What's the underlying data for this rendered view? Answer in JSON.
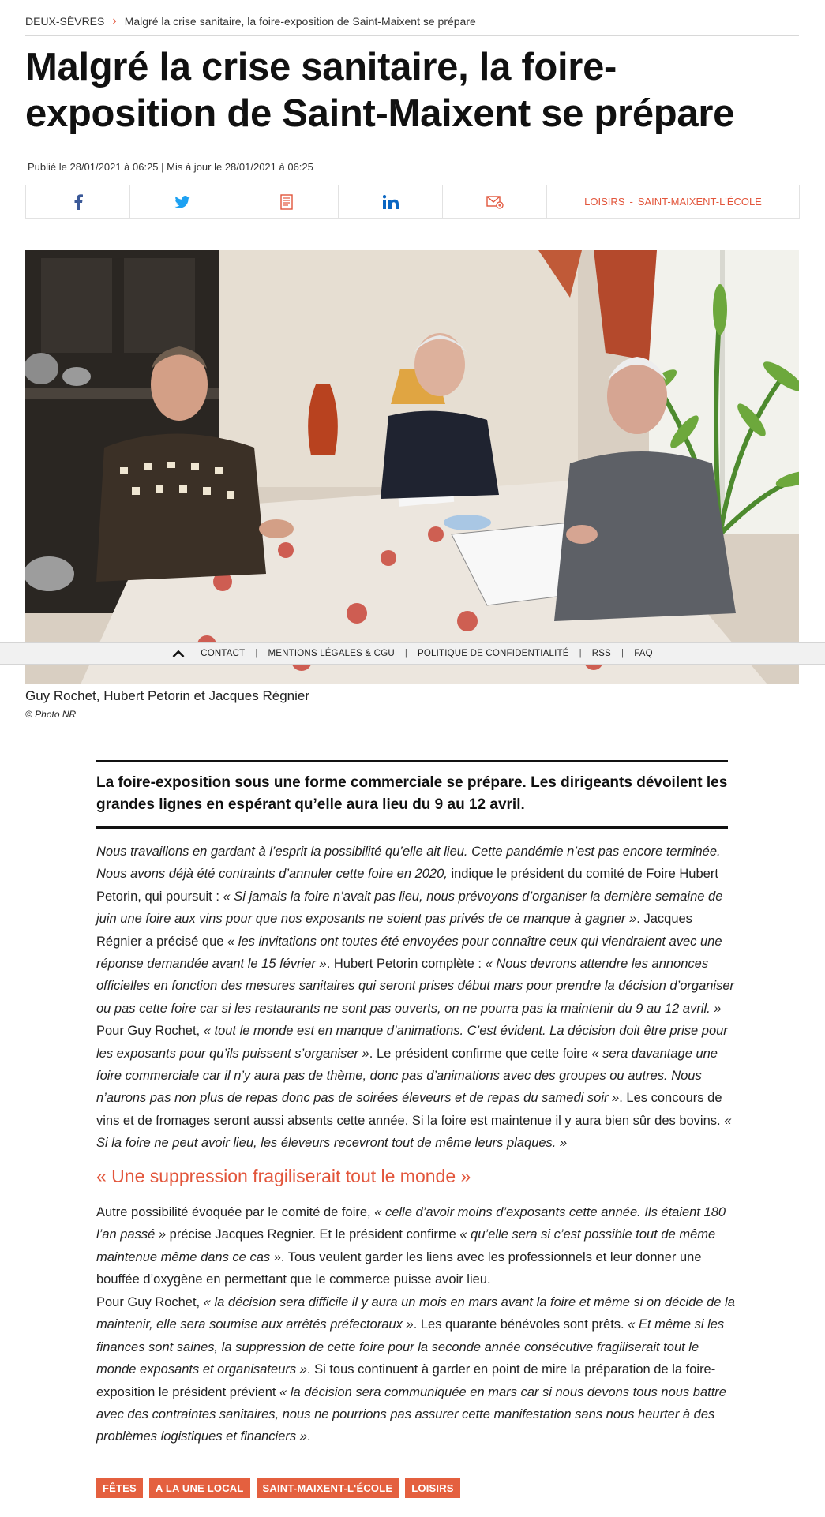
{
  "breadcrumb": {
    "section": "DEUX-SÈVRES",
    "separator": "›",
    "current": "Malgré la crise sanitaire, la foire-exposition de Saint-Maixent se prépare"
  },
  "article": {
    "title": "Malgré la crise sanitaire, la foire-exposition de Saint-Maixent se prépare",
    "dates": "Publié le 28/01/2021 à 06:25 | Mis à jour le 28/01/2021 à 06:25",
    "share": {
      "icons": [
        "facebook-icon",
        "twitter-icon",
        "print-icon",
        "linkedin-icon",
        "email-icon"
      ],
      "tag_1": "LOISIRS",
      "tag_dash": "-",
      "tag_2": "SAINT-MAIXENT-L'ÉCOLE"
    },
    "caption": "Guy Rochet, Hubert Petorin et Jacques Régnier",
    "credit": "© Photo NR",
    "chapo": "La foire-exposition sous une forme commerciale se prépare. Les dirigeants dévoilent les grandes lignes en espérant qu’elle aura lieu du 9 au 12 avril.",
    "p1": {
      "a": "Nous travaillons en gardant à l’esprit la possibilité qu’elle ait lieu. Cette pandémie n’est pas encore terminée. Nous avons déjà été contraints d’annuler cette foire en 2020,",
      "b": " indique le président du comité de Foire Hubert Petorin, qui poursuit : ",
      "c": "« Si jamais la foire n’avait pas lieu, nous prévoyons d’organiser la dernière semaine de juin une foire aux vins pour que nos exposants ne soient pas privés de ce manque à gagner »",
      "d": ". Jacques Régnier a précisé que ",
      "e": "« les invitations ont toutes été envoyées pour connaître ceux qui viendraient avec une réponse demandée avant le 15 février »",
      "f": ". Hubert Petorin complète : ",
      "g": "« Nous devrons attendre les annonces officielles en fonction des mesures sanitaires qui seront prises début mars pour prendre la décision d’organiser ou pas cette foire car si les restaurants ne sont pas ouverts, on ne pourra pas la maintenir du 9 au 12 avril. »",
      "h": " Pour Guy Rochet, ",
      "i": "« tout le monde est en manque d’animations. C’est évident. La décision doit être prise pour les exposants pour qu’ils puissent s’organiser »",
      "j": ". Le président confirme que cette foire ",
      "k": "« sera davantage une foire commerciale car il n’y aura pas de thème, donc pas d’animations avec des groupes ou autres. Nous n’aurons pas non plus de repas donc pas de soirées éleveurs et de repas du samedi soir »",
      "l": ". Les concours de vins et de fromages seront aussi absents cette année. Si la foire est maintenue il y aura bien sûr des bovins. ",
      "m": "« Si la foire ne peut avoir lieu, les éleveurs recevront tout de même leurs plaques. »"
    },
    "subhead": "« Une suppression fragiliserait tout le monde »",
    "p2": {
      "a": "Autre possibilité évoquée par le comité de foire, ",
      "b": "« celle d’avoir moins d’exposants cette année. Ils étaient 180 l’an passé »",
      "c": " précise Jacques Regnier. Et le président confirme ",
      "d": "« qu’elle sera si c’est possible tout de même maintenue même dans ce cas »",
      "e": ". Tous veulent garder les liens avec les professionnels et leur donner une bouffée d’oxygène en permettant que le commerce puisse avoir lieu."
    },
    "p3": {
      "a": "Pour Guy Rochet, ",
      "b": "« la décision sera difficile il y aura un mois en mars avant la foire et même si on décide de la maintenir, elle sera soumise aux arrêtés préfectoraux »",
      "c": ". Les quarante bénévoles sont prêts. ",
      "d": "« Et même si les finances sont saines, la suppression de cette foire pour la seconde année consécutive fragiliserait tout le monde exposants et organisateurs »",
      "e": ". Si tous continuent à garder en point de mire la préparation de la foire-exposition le président prévient ",
      "f": "« la décision sera communiquée en mars car si nous devons tous nous battre avec des contraintes sanitaires, nous ne pourrions pas assurer cette manifestation sans nous heurter à des problèmes logistiques et financiers »",
      "g": "."
    },
    "tags": [
      "FÊTES",
      "A LA UNE LOCAL",
      "SAINT-MAIXENT-L'ÉCOLE",
      "LOISIRS"
    ]
  },
  "footer_bar": {
    "items": [
      "CONTACT",
      "MENTIONS LÉGALES & CGU",
      "POLITIQUE DE CONFIDENTIALITÉ",
      "RSS",
      "FAQ"
    ],
    "separator": "|"
  },
  "colors": {
    "accent": "#e2553b",
    "tag_bg": "#e4603f",
    "facebook": "#3b5998",
    "twitter": "#1da1f2",
    "linkedin": "#0a66c2"
  }
}
